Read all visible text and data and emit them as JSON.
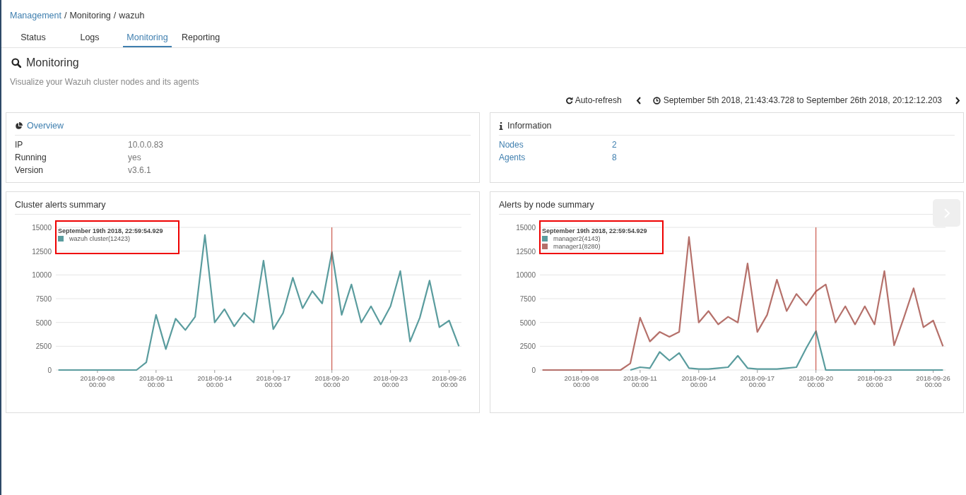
{
  "breadcrumb": [
    {
      "label": "Management",
      "kind": "link"
    },
    {
      "label": "/",
      "kind": "separator"
    },
    {
      "label": "Monitoring",
      "kind": "text"
    },
    {
      "label": "/",
      "kind": "separator"
    },
    {
      "label": "wazuh",
      "kind": "text"
    }
  ],
  "tabs": [
    {
      "label": "Status",
      "selected": false
    },
    {
      "label": "Logs",
      "selected": false
    },
    {
      "label": "Monitoring",
      "selected": true
    },
    {
      "label": "Reporting",
      "selected": false
    }
  ],
  "header": {
    "title": "Monitoring",
    "subtitle": "Visualize your Wazuh cluster nodes and its agents"
  },
  "time_bar": {
    "refresh": "Auto-refresh",
    "range": "September 5th 2018, 21:43:43.728 to September 26th 2018, 20:12:12.203"
  },
  "overview": {
    "title": "Overview",
    "rows": [
      {
        "label": "IP",
        "value": "10.0.0.83"
      },
      {
        "label": "Running",
        "value": "yes"
      },
      {
        "label": "Version",
        "value": "v3.6.1"
      }
    ]
  },
  "information": {
    "title": "Information",
    "rows": [
      {
        "label": "Nodes",
        "value": "2"
      },
      {
        "label": "Agents",
        "value": "8"
      }
    ]
  },
  "charts": [
    {
      "title": "Cluster alerts summary",
      "tooltip": {
        "title": "September 19th 2018, 22:59:54.929",
        "items": [
          {
            "label": "wazuh cluster(12423)",
            "color": "#5a9c9e"
          }
        ]
      },
      "chart_data": {
        "type": "line",
        "categories": [
          null,
          null,
          null,
          null,
          "2018-09-08 00:00",
          null,
          null,
          null,
          null,
          null,
          "2018-09-11 00:00",
          null,
          null,
          null,
          null,
          null,
          "2018-09-14 00:00",
          null,
          null,
          null,
          null,
          null,
          "2018-09-17 00:00",
          null,
          null,
          null,
          null,
          null,
          "2018-09-20 00:00",
          null,
          null,
          null,
          null,
          null,
          "2018-09-23 00:00",
          null,
          null,
          null,
          null,
          null,
          "2018-09-26 00:00",
          null
        ],
        "series": [
          {
            "color": "#5a9c9e",
            "values": [
              0,
              0,
              0,
              0,
              0,
              0,
              0,
              0,
              0,
              800,
              5800,
              2200,
              5400,
              4200,
              5600,
              14200,
              5000,
              6400,
              4600,
              6000,
              5000,
              11500,
              4300,
              6000,
              9700,
              6500,
              8300,
              7000,
              12400,
              5800,
              9000,
              5000,
              6700,
              4800,
              6700,
              10400,
              3000,
              5500,
              9400,
              4500,
              5200,
              2500
            ]
          }
        ],
        "ylim": [
          0,
          15000
        ],
        "yticks": [
          0,
          2500,
          5000,
          7500,
          10000,
          12500,
          15000
        ],
        "grid": true,
        "ref_lines": [
          {
            "axis": "x",
            "value": "2018-09-20 00:00"
          }
        ]
      }
    },
    {
      "title": "Alerts by node summary",
      "tooltip": {
        "title": "September 19th 2018, 22:59:54.929",
        "items": [
          {
            "label": "manager2(4143)",
            "color": "#5a9c9e"
          },
          {
            "label": "manager1(8280)",
            "color": "#b5706a"
          }
        ]
      },
      "chart_data": {
        "type": "line",
        "categories": [
          null,
          null,
          null,
          null,
          "2018-09-08 00:00",
          null,
          null,
          null,
          null,
          null,
          "2018-09-11 00:00",
          null,
          null,
          null,
          null,
          null,
          "2018-09-14 00:00",
          null,
          null,
          null,
          null,
          null,
          "2018-09-17 00:00",
          null,
          null,
          null,
          null,
          null,
          "2018-09-20 00:00",
          null,
          null,
          null,
          null,
          null,
          "2018-09-23 00:00",
          null,
          null,
          null,
          null,
          null,
          "2018-09-26 00:00",
          null
        ],
        "series": [
          {
            "color": "#5a9c9e",
            "values": [
              null,
              null,
              null,
              null,
              null,
              null,
              null,
              null,
              null,
              0,
              300,
              200,
              1900,
              1000,
              1800,
              200,
              100,
              100,
              200,
              300,
              1500,
              200,
              100,
              100,
              100,
              200,
              300,
              2300,
              4100,
              0,
              0,
              0,
              0,
              0,
              0,
              0,
              0,
              0,
              0,
              0,
              0,
              0
            ]
          },
          {
            "color": "#b5706a",
            "values": [
              0,
              0,
              0,
              0,
              0,
              0,
              0,
              0,
              0,
              700,
              5500,
              3000,
              4000,
              3500,
              4000,
              14000,
              5000,
              6200,
              4800,
              5600,
              5000,
              11200,
              4000,
              5800,
              9500,
              6200,
              8000,
              6800,
              8280,
              9000,
              5000,
              6700,
              4800,
              6700,
              4800,
              10400,
              2600,
              5500,
              8600,
              4500,
              5200,
              2500
            ]
          }
        ],
        "ylim": [
          0,
          15000
        ],
        "yticks": [
          0,
          2500,
          5000,
          7500,
          10000,
          12500,
          15000
        ],
        "grid": true,
        "ref_lines": [
          {
            "axis": "x",
            "value": "2018-09-20 00:00"
          }
        ]
      }
    }
  ]
}
